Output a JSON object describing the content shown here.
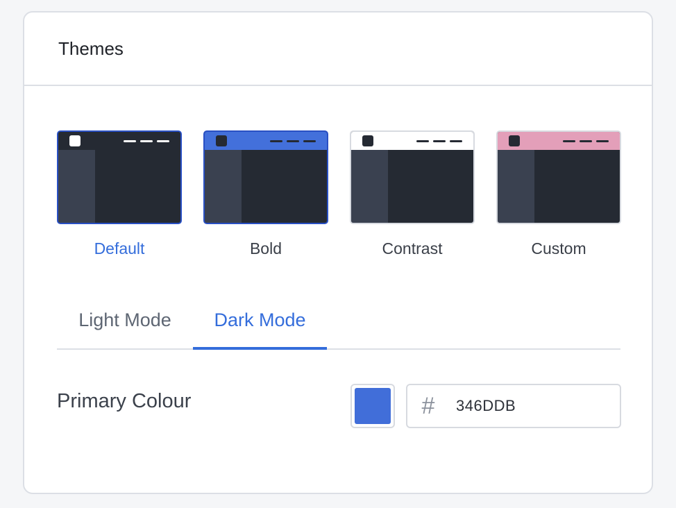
{
  "card": {
    "title": "Themes"
  },
  "themes": [
    {
      "label": "Default",
      "selected": true,
      "topbar_color": "#252a33",
      "logo_color": "#ffffff",
      "dash_color": "#ffffff"
    },
    {
      "label": "Bold",
      "selected": false,
      "topbar_color": "#4370db",
      "logo_color": "#252a33",
      "dash_color": "#252a33"
    },
    {
      "label": "Contrast",
      "selected": false,
      "topbar_color": "#ffffff",
      "logo_color": "#252a33",
      "dash_color": "#252a33"
    },
    {
      "label": "Custom",
      "selected": false,
      "topbar_color": "#e39fb9",
      "logo_color": "#252a33",
      "dash_color": "#252a33"
    }
  ],
  "tabs": [
    {
      "label": "Light Mode",
      "active": false
    },
    {
      "label": "Dark Mode",
      "active": true
    }
  ],
  "primary_colour": {
    "label": "Primary Colour",
    "hash_icon": "hash-icon",
    "value": "346DDB",
    "swatch_color": "#416ed9"
  },
  "colors": {
    "accent": "#346ddb",
    "body_dark": "#252a33",
    "sidebar": "#3a4150"
  }
}
